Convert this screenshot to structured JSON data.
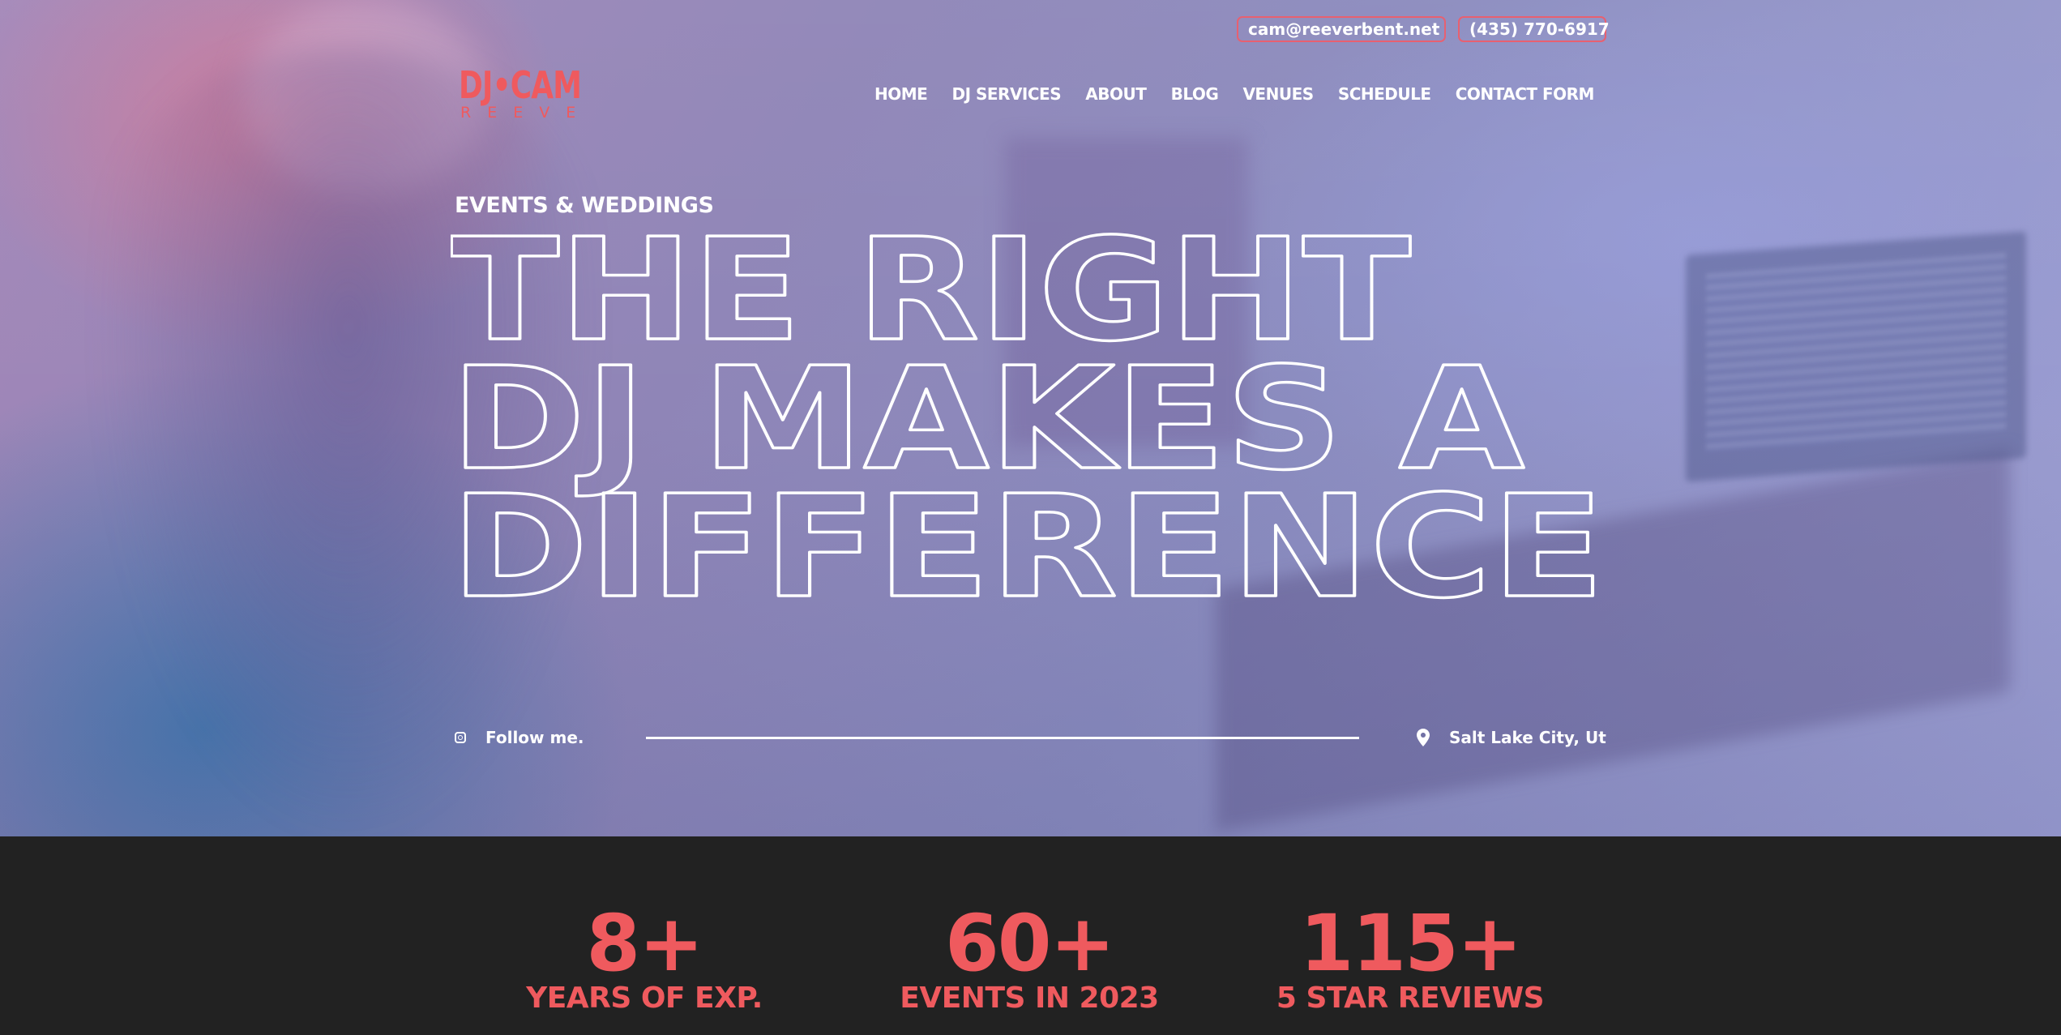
{
  "header": {
    "email": "cam@reeverbent.net",
    "phone": "(435) 770-6917",
    "logo": {
      "main": "DJ•CAM",
      "sub": "REEVE"
    },
    "nav": [
      {
        "label": "HOME"
      },
      {
        "label": "DJ SERVICES"
      },
      {
        "label": "ABOUT"
      },
      {
        "label": "BLOG"
      },
      {
        "label": "VENUES"
      },
      {
        "label": "SCHEDULE"
      },
      {
        "label": "CONTACT FORM"
      }
    ]
  },
  "hero": {
    "eyebrow": "EVENTS & WEDDINGS",
    "headline_lines": [
      "THE RIGHT",
      "DJ MAKES A",
      "DIFFERENCE"
    ],
    "follow_label": "Follow me.",
    "location": "Salt Lake City, Ut",
    "icons": {
      "follow": "instagram-icon",
      "location": "map-pin-icon"
    }
  },
  "stats": [
    {
      "value": "8+",
      "label": "YEARS OF EXP."
    },
    {
      "value": "60+",
      "label": "EVENTS IN 2023"
    },
    {
      "value": "115+",
      "label": "5 STAR REVIEWS"
    }
  ],
  "colors": {
    "accent": "#ef5a5e",
    "dark_band": "#222222",
    "text_light": "#ffffff"
  }
}
